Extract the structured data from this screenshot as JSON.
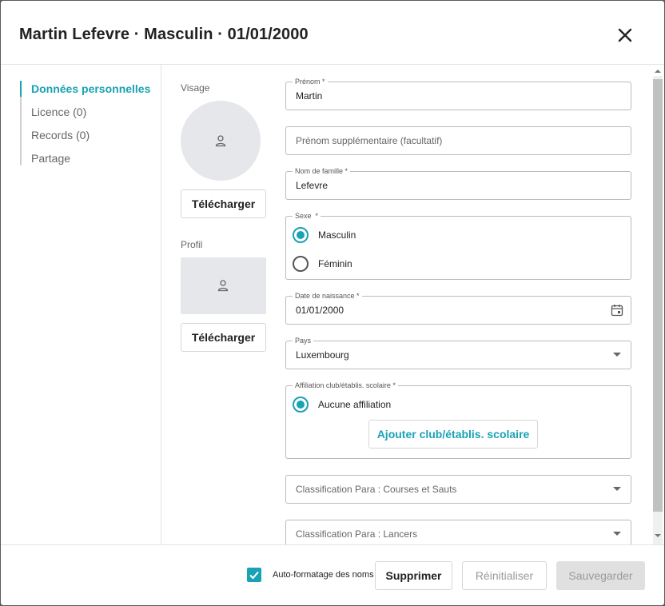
{
  "header": {
    "title": "Martin Lefevre · Masculin · 01/01/2000",
    "close_icon": "close-icon"
  },
  "nav": {
    "items": [
      {
        "label": "Données personnelles",
        "active": true
      },
      {
        "label": "Licence (0)",
        "active": false
      },
      {
        "label": "Records (0)",
        "active": false
      },
      {
        "label": "Partage",
        "active": false
      }
    ]
  },
  "media": {
    "visage_label": "Visage",
    "visage_upload": "Télécharger",
    "profil_label": "Profil",
    "profil_upload": "Télécharger",
    "placeholder_icon": "person-icon"
  },
  "form": {
    "prenom": {
      "label": "Prénom *",
      "value": "Martin"
    },
    "prenom_sup": {
      "placeholder": "Prénom supplémentaire (facultatif)"
    },
    "nom": {
      "label": "Nom de famille *",
      "value": "Lefevre"
    },
    "sexe": {
      "label": "Sexe  *",
      "options": [
        "Masculin",
        "Féminin"
      ],
      "selected": "Masculin"
    },
    "naissance": {
      "label": "Date de naissance *",
      "value": "01/01/2000",
      "icon": "calendar-icon"
    },
    "pays": {
      "label": "Pays",
      "value": "Luxembourg"
    },
    "affiliation": {
      "label": "Affiliation club/établis. scolaire *",
      "option": "Aucune affiliation",
      "add_button": "Ajouter club/établis. scolaire"
    },
    "class_courses": {
      "placeholder": "Classification Para : Courses et Sauts"
    },
    "class_lancers": {
      "placeholder": "Classification Para : Lancers"
    }
  },
  "footer": {
    "auto_format_label": "Auto-formatage des noms",
    "auto_format_checked": true,
    "delete_label": "Supprimer",
    "reset_label": "Réinitialiser",
    "save_label": "Sauvegarder"
  },
  "colors": {
    "accent": "#19a2b4",
    "disabled_bg": "#e0e0e0",
    "disabled_text": "#9a9a9a"
  }
}
